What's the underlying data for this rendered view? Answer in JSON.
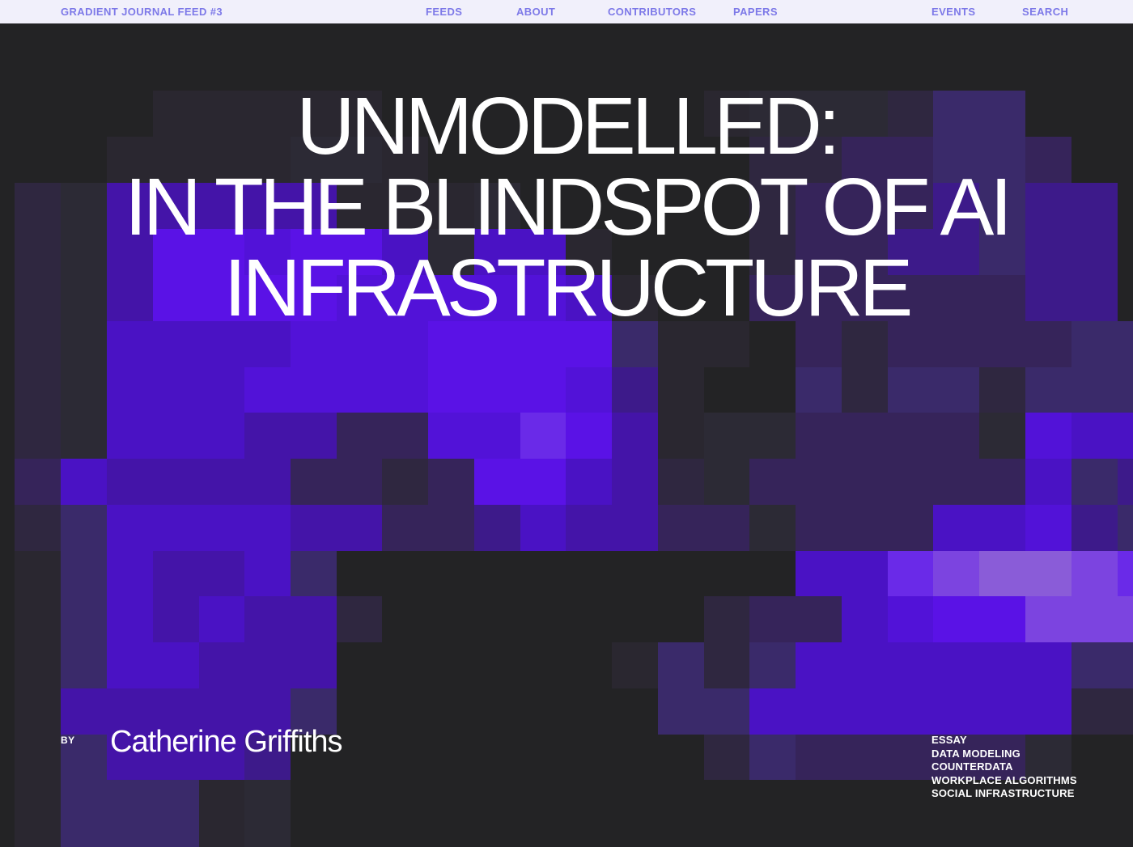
{
  "nav": {
    "brand": "GRADIENT JOURNAL FEED #3",
    "links": [
      "FEEDS",
      "ABOUT",
      "CONTRIBUTORS",
      "PAPERS",
      "EVENTS",
      "SEARCH"
    ]
  },
  "article": {
    "title_lines": [
      "UNMODELLED:",
      "IN THE BLINDSPOT OF AI",
      "INFRASTRUCTURE"
    ],
    "by_label": "BY",
    "author": "Catherine Griffiths",
    "tags": [
      "ESSAY",
      "DATA MODELING",
      "COUNTERDATA",
      "WORKPLACE ALGORITHMS",
      "SOCIAL INFRASTRUCTURE"
    ]
  },
  "colors": {
    "nav_background": "#f1f0fb",
    "nav_text": "#7d79e8",
    "page_background": "#222224",
    "accent_violet": "#5a12e6",
    "text_white": "#ffffff"
  }
}
